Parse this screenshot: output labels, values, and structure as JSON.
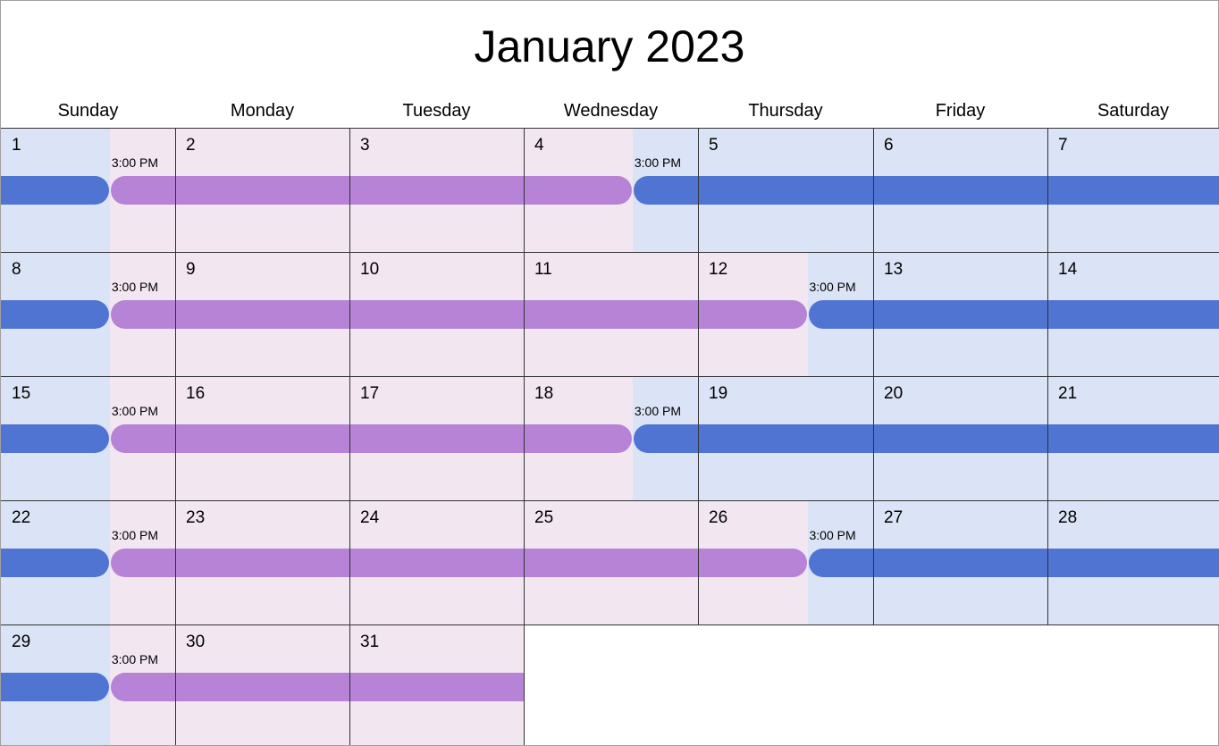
{
  "title": "January 2023",
  "colors": {
    "blue_bar": "#4f74d2",
    "purple_bar": "#b683d6",
    "blue_bg": "#dbe3f6",
    "purple_bg": "#f2e6f1",
    "grid_line": "#333333"
  },
  "weekdays": [
    "Sunday",
    "Monday",
    "Tuesday",
    "Wednesday",
    "Thursday",
    "Friday",
    "Saturday"
  ],
  "weeks": [
    {
      "days": [
        "1",
        "2",
        "3",
        "4",
        "5",
        "6",
        "7"
      ],
      "switch_day": "Wednesday",
      "switch_label": "3:00 PM"
    },
    {
      "days": [
        "8",
        "9",
        "10",
        "11",
        "12",
        "13",
        "14"
      ],
      "switch_day": "Thursday",
      "switch_label": "3:00 PM"
    },
    {
      "days": [
        "15",
        "16",
        "17",
        "18",
        "19",
        "20",
        "21"
      ],
      "switch_day": "Wednesday",
      "switch_label": "3:00 PM"
    },
    {
      "days": [
        "22",
        "23",
        "24",
        "25",
        "26",
        "27",
        "28"
      ],
      "switch_day": "Thursday",
      "switch_label": "3:00 PM"
    },
    {
      "days": [
        "29",
        "30",
        "31"
      ],
      "switch_day": null,
      "switch_label": null
    }
  ],
  "schedule": {
    "pattern": "Sunday 3:00 PM handoff from blue to purple; midweek 3:00 PM handoff from purple back to blue",
    "sunday_switch_label": "3:00 PM",
    "segments": [
      {
        "week": 1,
        "color": "blue",
        "from_day": 0,
        "from_frac": 0,
        "to_day": 0,
        "to_frac": 0.625
      },
      {
        "week": 1,
        "color": "purple",
        "from_day": 0,
        "from_frac": 0.625,
        "to_day": 3,
        "to_frac": 0.625
      },
      {
        "week": 1,
        "color": "blue",
        "from_day": 3,
        "from_frac": 0.625,
        "to_day": 6,
        "to_frac": 1
      },
      {
        "week": 2,
        "color": "blue",
        "from_day": 0,
        "from_frac": 0,
        "to_day": 0,
        "to_frac": 0.625
      },
      {
        "week": 2,
        "color": "purple",
        "from_day": 0,
        "from_frac": 0.625,
        "to_day": 4,
        "to_frac": 0.625
      },
      {
        "week": 2,
        "color": "blue",
        "from_day": 4,
        "from_frac": 0.625,
        "to_day": 6,
        "to_frac": 1
      },
      {
        "week": 3,
        "color": "blue",
        "from_day": 0,
        "from_frac": 0,
        "to_day": 0,
        "to_frac": 0.625
      },
      {
        "week": 3,
        "color": "purple",
        "from_day": 0,
        "from_frac": 0.625,
        "to_day": 3,
        "to_frac": 0.625
      },
      {
        "week": 3,
        "color": "blue",
        "from_day": 3,
        "from_frac": 0.625,
        "to_day": 6,
        "to_frac": 1
      },
      {
        "week": 4,
        "color": "blue",
        "from_day": 0,
        "from_frac": 0,
        "to_day": 0,
        "to_frac": 0.625
      },
      {
        "week": 4,
        "color": "purple",
        "from_day": 0,
        "from_frac": 0.625,
        "to_day": 4,
        "to_frac": 0.625
      },
      {
        "week": 4,
        "color": "blue",
        "from_day": 4,
        "from_frac": 0.625,
        "to_day": 6,
        "to_frac": 1
      },
      {
        "week": 5,
        "color": "blue",
        "from_day": 0,
        "from_frac": 0,
        "to_day": 0,
        "to_frac": 0.625
      },
      {
        "week": 5,
        "color": "purple",
        "from_day": 0,
        "from_frac": 0.625,
        "to_day": 2,
        "to_frac": 1
      }
    ]
  }
}
